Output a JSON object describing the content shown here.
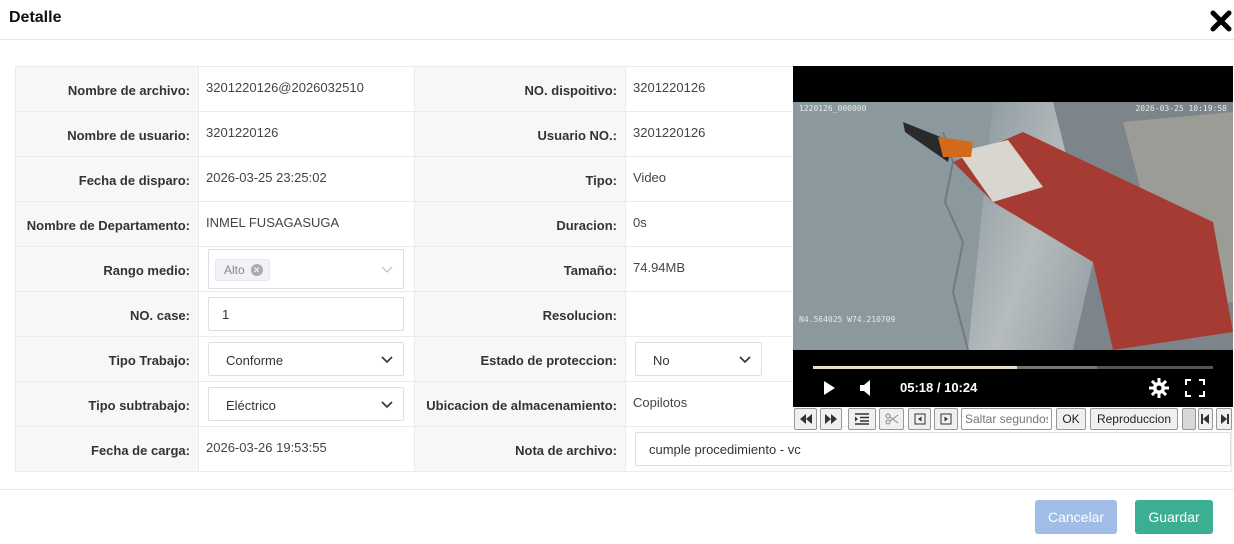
{
  "dialog": {
    "title": "Detalle"
  },
  "labels": {
    "file_name": "Nombre de archivo:",
    "user_name": "Nombre de usuario:",
    "trigger_date": "Fecha de disparo:",
    "department": "Nombre de Departamento:",
    "range": "Rango medio:",
    "case_no": "NO. case:",
    "work_type": "Tipo Trabajo:",
    "subwork_type": "Tipo subtrabajo:",
    "upload_date": "Fecha de carga:",
    "device_no": "NO. dispoitivo:",
    "user_no": "Usuario NO.:",
    "type": "Tipo:",
    "duration": "Duracion:",
    "size": "Tamaño:",
    "resolution": "Resolucion:",
    "protection_state": "Estado de proteccion:",
    "storage_location": "Ubicacion de almacenamiento:",
    "file_note": "Nota de archivo:"
  },
  "values": {
    "file_name": "3201220126@2026032510",
    "user_name": "3201220126",
    "trigger_date": "2026-03-25 23:25:02",
    "department": "INMEL FUSAGASUGA",
    "range_tag": "Alto",
    "case_no": "1",
    "work_type": "Conforme",
    "subwork_type": "Eléctrico",
    "upload_date": "2026-03-26 19:53:55",
    "device_no": "3201220126",
    "user_no": "3201220126",
    "type": "Video",
    "duration": "0s",
    "size": "74.94MB",
    "resolution": "",
    "protection_state": "No",
    "storage_location": "Copilotos",
    "file_note": "cumple procedimiento - vc"
  },
  "video": {
    "osd_top_left": "1220126_000000",
    "osd_top_right": "2026-03-25 10:19:58",
    "osd_bottom_left": "N4.564025  W74.210709",
    "time": "05:18 / 10:24",
    "progress": 0.51,
    "buffered": 0.71
  },
  "video_toolbar": {
    "skip_placeholder": "Saltar segundos",
    "ok": "OK",
    "playback": "Reproduccion"
  },
  "footer": {
    "cancel": "Cancelar",
    "save": "Guardar"
  },
  "colors": {
    "cancel_bg": "#9fbde6",
    "save_bg": "#3cae93",
    "progress": "#e9dfc8"
  }
}
